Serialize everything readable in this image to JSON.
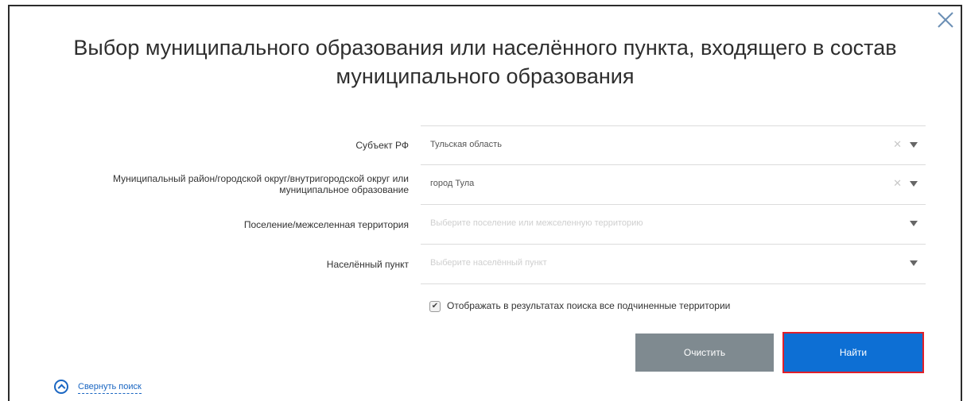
{
  "dialog": {
    "title": "Выбор муниципального образования или населённого пункта, входящего в состав муниципального образования",
    "close_icon": "close-icon"
  },
  "form": {
    "subject": {
      "label": "Субъект РФ",
      "value": "Тульская область"
    },
    "district": {
      "label": "Муниципальный район/городской округ/внутригородской округ или муниципальное образование",
      "value": "город Тула"
    },
    "settlement": {
      "label": "Поселение/межселенная территория",
      "placeholder": "Выберите поселение или межселенную территорию"
    },
    "locality": {
      "label": "Населённый пункт",
      "placeholder": "Выберите населённый пункт"
    },
    "show_subordinate": {
      "label": "Отображать в результатах поиска все подчиненные территории",
      "checked": true
    }
  },
  "buttons": {
    "clear_label": "Очистить",
    "find_label": "Найти"
  },
  "collapse": {
    "label": "Свернуть поиск"
  },
  "colors": {
    "primary": "#0d6fd4",
    "secondary": "#7f8a90",
    "highlight": "#e0202a",
    "link": "#1a66c2"
  }
}
